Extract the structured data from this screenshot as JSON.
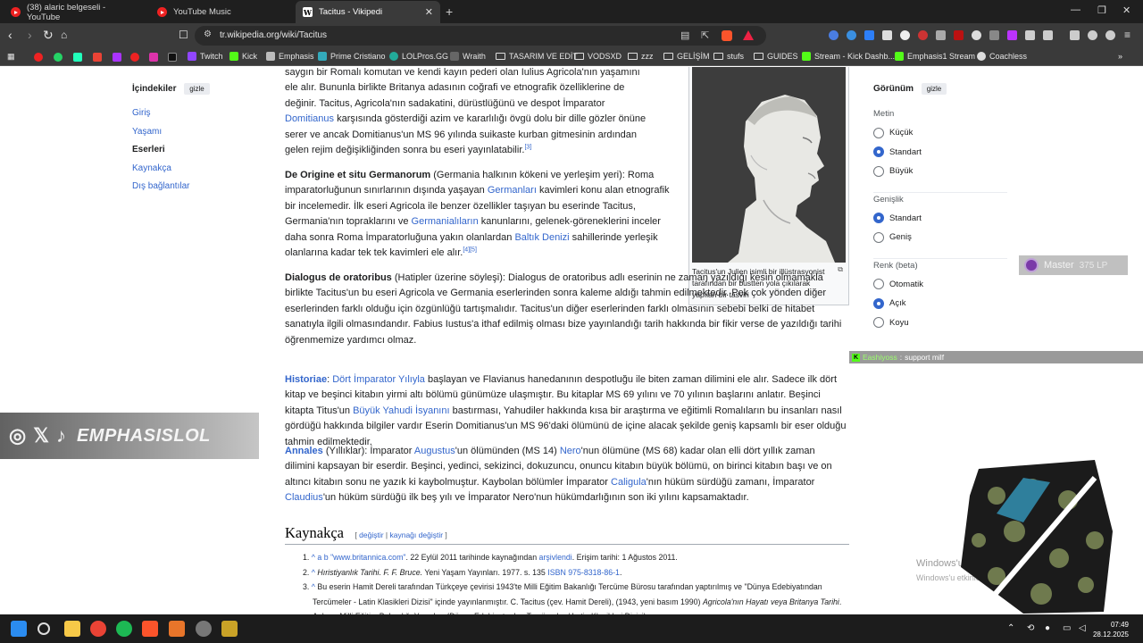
{
  "tabs": [
    {
      "title": "(38) alaric belgeseli - YouTube"
    },
    {
      "title": "YouTube Music"
    },
    {
      "title": "Tacitus - Vikipedi"
    }
  ],
  "address": {
    "url": "tr.wikipedia.org/wiki/Tacitus"
  },
  "bookmarks": [
    {
      "label": "Twitch"
    },
    {
      "label": "Kick"
    },
    {
      "label": "Emphasis"
    },
    {
      "label": "Prime Cristiano"
    },
    {
      "label": "LOLPros.GG"
    },
    {
      "label": "Wraith"
    },
    {
      "label": "TASARIM VE EDİT"
    },
    {
      "label": "VODSXD"
    },
    {
      "label": "zzz"
    },
    {
      "label": "GELİŞİM"
    },
    {
      "label": "stufs"
    },
    {
      "label": "GUIDES"
    },
    {
      "label": "Stream - Kick Dashb..."
    },
    {
      "label": "Emphasis1 Stream"
    },
    {
      "label": "Coachless"
    }
  ],
  "toc": {
    "title": "İçindekiler",
    "hide": "gizle",
    "items": [
      "Giriş",
      "Yaşamı",
      "Eserleri",
      "Kaynakça",
      "Dış bağlantılar"
    ]
  },
  "infobox": {
    "caption": "Tacitus'un Julien isimli bir illüstrasyonist tarafından bir büstten yola çıkılarak yapılan bir tasviri"
  },
  "article": {
    "p1": {
      "t1": "saygın bir Romalı komutan ve kendi kayın pederi olan Iulius Agricola'nın yaşamını ele alır. Bununla birlikte Britanya adasının coğrafi ve etnografik özelliklerine de değinir. Tacitus, Agricola'nın sadakatini, dürüstlüğünü ve despot İmparator ",
      "l1": "Domitianus",
      "t2": " karşısında gösterdiği azim ve kararlılığı övgü dolu bir dille gözler önüne serer ve ancak Domitianus'un MS 96 yılında suikaste kurban gitmesinin ardından gelen rejim değişikliğinden sonra bu eseri yayınlatabilir.",
      "ref": "[3]"
    },
    "p2": {
      "bold": "De Origine et situ Germanorum",
      "t1": " (Germania halkının kökeni ve yerleşim yeri): Roma imparatorluğunun sınırlarının dışında yaşayan ",
      "l1": "Germanları",
      "t2": " kavimleri konu alan etnografik bir incelemedir. İlk eseri Agricola ile benzer özellikler taşıyan bu eserinde Tacitus, Germania'nın topraklarını ve ",
      "l2": "Germanialıların",
      "t3": " kanunlarını, gelenek-göreneklerini inceler daha sonra Roma İmparatorluğuna yakın olanlardan ",
      "l3": "Baltık Denizi",
      "t4": " sahillerinde yerleşik olanlarına kadar tek tek kavimleri ele alır.",
      "ref": "[4][5]"
    },
    "p3": {
      "bold": "Dialogus de oratoribus",
      "t1": " (Hatipler üzerine söyleşi): Dialogus de oratoribus adlı eserinin ne zaman yazıldığı kesin olmamakla birlikte Tacitus'un bu eseri Agricola ve Germania eserlerinden sonra kaleme aldığı tahmin edilmektedir. Pek çok yönden diğer eserlerinden farklı olduğu için özgünlüğü tartışmalıdır. Tacitus'un diğer eserlerinden farklı olmasının sebebi belki de hitabet sanatıyla ilgili olmasındandır. Fabius Iustus'a ithaf edilmiş olması bize yayınlandığı tarih hakkında bir fikir verse de yazıldığı tarihi öğrenmemize yardımcı olmaz."
    },
    "p4": {
      "l0": "Historiae",
      "t0": ": ",
      "l1": "Dört İmparator Yılıyla",
      "t1": " başlayan ve Flavianus hanedanının despotluğu ile biten zaman dilimini ele alır. Sadece ilk dört kitap ve beşinci kitabın yirmi altı bölümü günümüze ulaşmıştır. Bu kitaplar MS 69 yılını ve 70 yılının başlarını anlatır. Beşinci kitapta Titus'un ",
      "l2": "Büyük Yahudi İsyanını",
      "t2": " bastırması, Yahudiler hakkında kısa bir araştırma ve eğitimli Romalıların bu insanları nasıl gördüğü hakkında bilgiler vardır Eserin Domitianus'un MS 96'daki ölümünü de içine alacak şekilde geniş kapsamlı bir eser olduğu tahmin edilmektedir."
    },
    "p5": {
      "l0": "Annales",
      "t0": " (Yıllıklar): İmparator ",
      "l1": "Augustus",
      "t1": "'un ölümünden (MS 14) ",
      "l2": "Nero",
      "t2": "'nun ölümüne (MS 68) kadar olan elli dört yıllık zaman dilimini kapsayan bir eserdir. Beşinci, yedinci, sekizinci, dokuzuncu, onuncu kitabın büyük bölümü, on birinci kitabın başı ve on altıncı kitabın sonu ne yazık ki kaybolmuştur. Kaybolan bölümler İmparator ",
      "l3": "Caligula",
      "t3": "'nın hüküm sürdüğü zamanı, İmparator ",
      "l4": "Claudius",
      "t4": "'un hüküm sürdüğü ilk beş yılı ve İmparator Nero'nun hükümdarlığının son iki yılını kapsamaktadır."
    }
  },
  "references": {
    "heading": "Kaynakça",
    "edit1": "değiştir",
    "edit2": "kaynağı değiştir",
    "items": [
      {
        "num": "1.",
        "mark": "^ a b",
        "l1": "\"www.britannica.com\"",
        "t1": ". 22 Eylül 2011 tarihinde kaynağından ",
        "l2": "arşivlendi",
        "t2": ". Erişim tarihi: 1 Ağustos 2011."
      },
      {
        "num": "2.",
        "mark": "^",
        "i1": "Hıristiyanlık Tarihi. F. F. Bruce.",
        "t1": " Yeni Yaşam Yayınları. 1977. s. 135 ",
        "l1": "ISBN 975-8318-86-1",
        "t2": "."
      },
      {
        "num": "3.",
        "mark": "^",
        "t1": "Bu eserin Hamit Dereli tarafından Türkçeye çevirisi 1943'te Milli Eğitim Bakanlığı Tercüme Bürosu tarafından yaptırılmış ve \"Dünya Edebiyatından Tercümeler - Latin Klasikleri Dizisi\" içinde yayınlanmıştır. C. Tacitus (çev. Hamit Dereli), (1943, yeni basım 1990) ",
        "i1": "Agricola'nın Hayatı veya Britanya Tarihi",
        "t2": ". Ankara Milli Eğitim Bakanlığı Yayınları (Dünya Edebiyatından Tercümeler / Latin Klasikleri Dizisi)"
      }
    ]
  },
  "appearance": {
    "title": "Görünüm",
    "hide": "gizle",
    "sections": [
      {
        "label": "Metin",
        "options": [
          {
            "label": "Küçük",
            "selected": false
          },
          {
            "label": "Standart",
            "selected": true
          },
          {
            "label": "Büyük",
            "selected": false
          }
        ]
      },
      {
        "label": "Genişlik",
        "options": [
          {
            "label": "Standart",
            "selected": true
          },
          {
            "label": "Geniş",
            "selected": false
          }
        ]
      },
      {
        "label": "Renk (beta)",
        "options": [
          {
            "label": "Otomatik",
            "selected": false
          },
          {
            "label": "Açık",
            "selected": true
          },
          {
            "label": "Koyu",
            "selected": false
          }
        ]
      }
    ]
  },
  "overlays": {
    "master_label": "Master",
    "master_lp": "375 LP",
    "support_user": "Eashiyoss",
    "support_text": "support milf",
    "social_name": "EMPHASISLOL",
    "watermark_title": "Windows'u Etkinleştir",
    "watermark_sub": "Windows'u etkinleştirmek için Ayarlar'a gidin."
  },
  "taskbar": {
    "time": "07:49",
    "date": "28.12.2025"
  },
  "colors": {
    "link": "#3366cc",
    "chrome_bg": "#3a3a3a",
    "tabbar_bg": "#1f1f1f",
    "taskbar_bg": "#1c1c1c",
    "kick_green": "#53fc18"
  }
}
